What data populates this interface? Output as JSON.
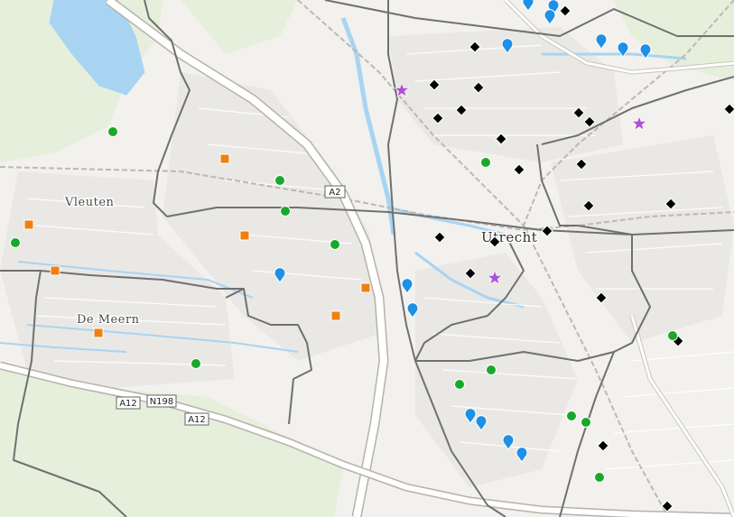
{
  "map": {
    "labels": {
      "vleuten": "Vleuten",
      "de_meern": "De Meern",
      "utrecht": "Utrecht"
    },
    "road_shields": {
      "a2": "A2",
      "a12_left": "A12",
      "n198": "N198",
      "a12_right": "A12"
    },
    "colors": {
      "background": "#f2f1ee",
      "water": "#a8d4f2",
      "green_area": "#e3eed6",
      "road_major": "#ffffff",
      "road_casing": "#c9c5c0",
      "district_boundary": "#707070",
      "marker_black": "#000000",
      "marker_blue": "#1e90e6",
      "marker_green": "#1aa82a",
      "marker_orange": "#f07f10",
      "marker_purple": "#b04fd6"
    },
    "marker_categories": {
      "black": "diamond-icon",
      "blue": "pin-icon",
      "green": "circle-icon",
      "orange": "square-icon",
      "purple": "star-icon"
    }
  }
}
